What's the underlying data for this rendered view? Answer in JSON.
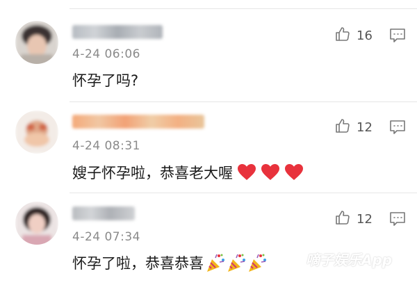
{
  "comments": [
    {
      "time": "4-24 06:06",
      "text": "怀孕了吗?",
      "likes": "16",
      "emojis": []
    },
    {
      "time": "4-24 08:31",
      "text": "嫂子怀孕啦，恭喜老大喔",
      "likes": "12",
      "emojis": [
        "heart",
        "heart",
        "heart"
      ]
    },
    {
      "time": "4-24 07:34",
      "text": "怀孕了啦，恭喜恭喜",
      "likes": "12",
      "emojis": [
        "party-popper",
        "party-popper",
        "party-popper"
      ]
    }
  ],
  "icons": {
    "like": "thumbs-up-icon",
    "reply": "comment-icon"
  },
  "watermark": "嘀子娱乐App",
  "colors": {
    "heart": "#e8323c",
    "icon": "#777777",
    "time": "#8a8a8a"
  }
}
